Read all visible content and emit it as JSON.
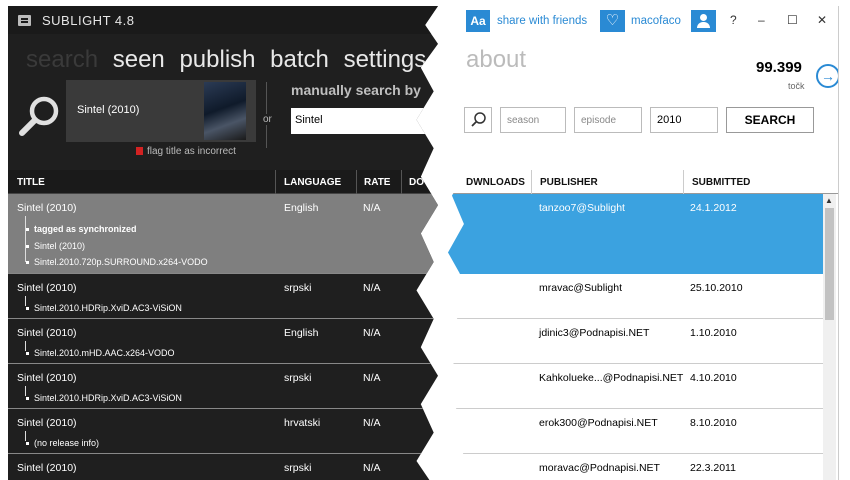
{
  "app": {
    "name": "SUBLIGHT 4.8",
    "tabs": [
      "search",
      "seen",
      "publish",
      "batch",
      "settings",
      "ab"
    ],
    "active_tab": "search",
    "about_tab": "about"
  },
  "search_panel": {
    "movie_title": "Sintel (2010)",
    "flag_label": "flag title as incorrect",
    "or_label": "or",
    "manual_label": "manually search by",
    "manual_value": "Sintel",
    "season_placeholder": "season",
    "episode_placeholder": "episode",
    "year_value": "2010",
    "search_button": "SEARCH"
  },
  "header": {
    "share_label": "share with friends",
    "username": "macofaco",
    "help": "?",
    "minimize": "‒",
    "maximize": "☐",
    "close": "✕",
    "points": "99.399",
    "points_unit": "točk",
    "arrow": "→"
  },
  "columns": {
    "title": "TITLE",
    "language": "LANGUAGE",
    "rate": "RATE",
    "do": "DO",
    "downloads": "DWNLOADS",
    "publisher": "PUBLISHER",
    "submitted": "SUBMITTED"
  },
  "rows": [
    {
      "title": "Sintel (2010)",
      "language": "English",
      "rate": "N/A",
      "subs": [
        "tagged as synchronized",
        "Sintel (2010)",
        "Sintel.2010.720p.SURROUND.x264-VODO"
      ],
      "publisher": "tanzoo7@Sublight",
      "submitted": "24.1.2012"
    },
    {
      "title": "Sintel (2010)",
      "language": "srpski",
      "rate": "N/A",
      "subs": [
        "Sintel.2010.HDRip.XviD.AC3-ViSiON"
      ],
      "publisher": "mravac@Sublight",
      "submitted": "25.10.2010"
    },
    {
      "title": "Sintel (2010)",
      "language": "English",
      "rate": "N/A",
      "subs": [
        "Sintel.2010.mHD.AAC.x264-VODO"
      ],
      "publisher": "jdinic3@Podnapisi.NET",
      "submitted": "1.10.2010"
    },
    {
      "title": "Sintel (2010)",
      "language": "srpski",
      "rate": "N/A",
      "subs": [
        "Sintel.2010.HDRip.XviD.AC3-ViSiON"
      ],
      "publisher": "Kahkolueke...@Podnapisi.NET",
      "submitted": "4.10.2010"
    },
    {
      "title": "Sintel (2010)",
      "language": "hrvatski",
      "rate": "N/A",
      "subs": [
        "(no release info)"
      ],
      "publisher": "erok300@Podnapisi.NET",
      "submitted": "8.10.2010"
    },
    {
      "title": "Sintel (2010)",
      "language": "srpski",
      "rate": "N/A",
      "subs": [],
      "publisher": "moravac@Podnapisi.NET",
      "submitted": "22.3.2011"
    }
  ],
  "colors": {
    "accent": "#2a8ad4",
    "selected_row_dark": "#7f7f7f",
    "selected_row_light": "#3ba2e0",
    "flag": "#d32222"
  },
  "icons": [
    "app-logo-icon",
    "magnifier-icon",
    "flag-icon",
    "font-size-icon",
    "heart-icon",
    "user-icon",
    "arrow-right-icon",
    "search-icon"
  ]
}
